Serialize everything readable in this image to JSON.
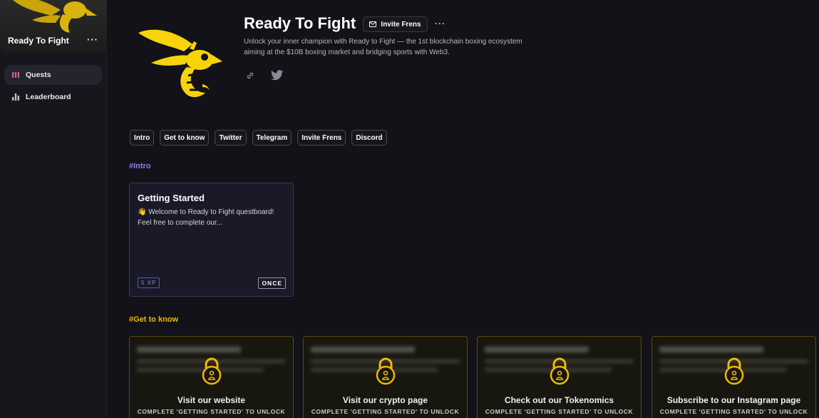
{
  "sidebar": {
    "project_name": "Ready To Fight",
    "more_label": "···",
    "nav": [
      {
        "label": "Quests",
        "icon": "quests-icon",
        "active": true,
        "icon_color": "#d45fa8"
      },
      {
        "label": "Leaderboard",
        "icon": "leaderboard-icon",
        "active": false,
        "icon_color": "#bdbdc6"
      }
    ]
  },
  "header": {
    "title": "Ready To Fight",
    "invite_label": "Invite Frens",
    "more_label": "···",
    "description": "Unlock your inner champion with Ready to Fight — the 1st blockchain boxing ecosystem aiming at the $10B boxing market and bridging sports with Web3.",
    "social": [
      "link-icon",
      "twitter-icon"
    ]
  },
  "tabs": [
    "Intro",
    "Get to know",
    "Twitter",
    "Telegram",
    "Invite Frens",
    "Discord"
  ],
  "sections": {
    "intro": {
      "heading": "#Intro",
      "card": {
        "title": "Getting Started",
        "text": "👋 Welcome to Ready to Fight questboard! Feel free to complete our...",
        "xp": "5 XP",
        "frequency": "ONCE"
      }
    },
    "get_to_know": {
      "heading": "#Get to know",
      "cards": [
        {
          "title": "Visit our website",
          "unlock": "COMPLETE 'GETTING STARTED' TO UNLOCK"
        },
        {
          "title": "Visit our crypto page",
          "unlock": "COMPLETE 'GETTING STARTED' TO UNLOCK"
        },
        {
          "title": "Check out our Tokenomics",
          "unlock": "COMPLETE 'GETTING STARTED' TO UNLOCK"
        },
        {
          "title": "Subscribe to our Instagram page",
          "unlock": "COMPLETE 'GETTING STARTED' TO UNLOCK"
        }
      ]
    }
  },
  "colors": {
    "accent_purple": "#8b82e6",
    "accent_gold": "#f2b705",
    "brand_yellow": "#f7d40a"
  }
}
